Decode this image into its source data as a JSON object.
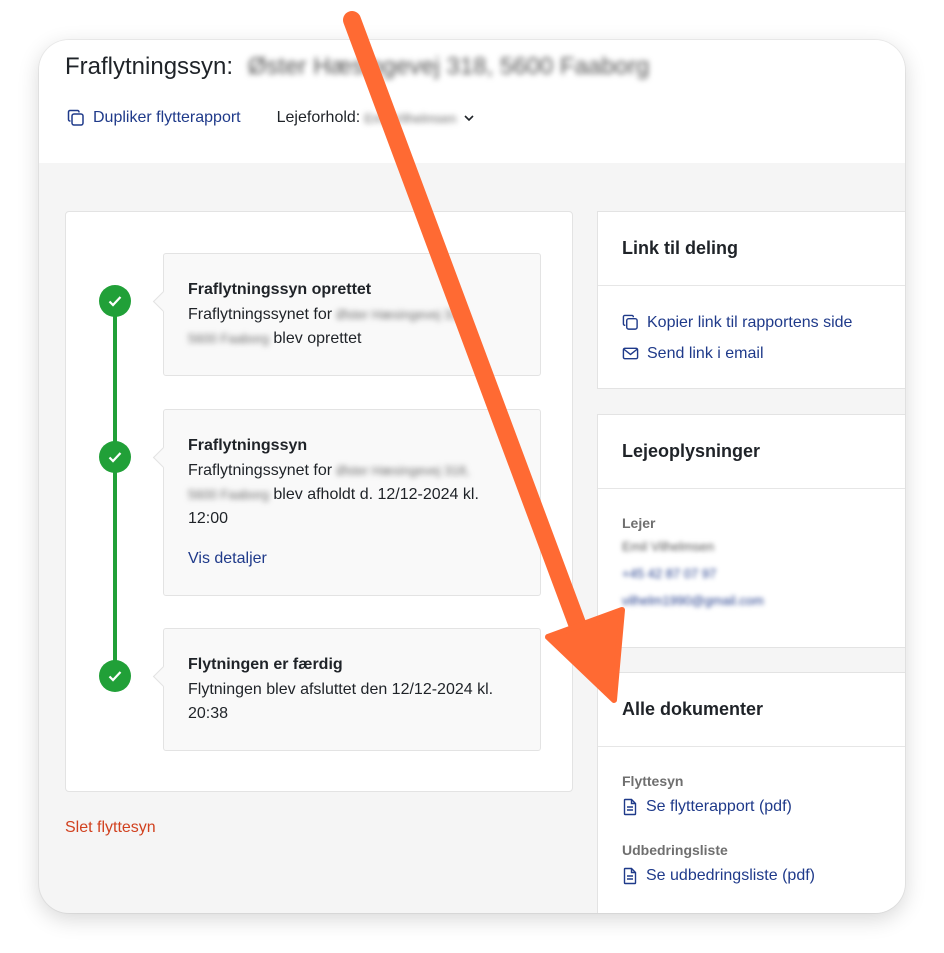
{
  "header": {
    "title_prefix": "Fraflytningssyn:",
    "address": "Øster Hæsingevej 318, 5600 Faaborg",
    "duplicate_label": "Dupliker flytterapport",
    "tenancy_label": "Lejeforhold:",
    "tenancy_value": "Emil Vilhelmsen"
  },
  "timeline": {
    "events": [
      {
        "title": "Fraflytningssyn oprettet",
        "text_before": "Fraflytningssynet for",
        "address_line1": "Øster Hæsingevej 318,",
        "address_line2": "5600 Faaborg",
        "text_after": "blev oprettet"
      },
      {
        "title": "Fraflytningssyn",
        "text_before": "Fraflytningssynet for",
        "address_line1": "Øster Hæsingevej 318,",
        "address_line2": "5600 Faaborg",
        "text_after": "blev afholdt d. 12/12-2024 kl.",
        "text_after_2": "12:00",
        "details_link": "Vis detaljer"
      },
      {
        "title": "Flytningen er færdig",
        "line1": "Flytningen blev afsluttet den 12/12-2024 kl.",
        "line2": "20:38"
      }
    ],
    "delete_label": "Slet flyttesyn"
  },
  "share": {
    "title": "Link til deling",
    "copy_label": "Kopier link til rapportens side",
    "email_label": "Send link i email"
  },
  "tenant": {
    "title": "Lejeoplysninger",
    "label": "Lejer",
    "name": "Emil Vilhelmsen",
    "phone": "+45 42 87 07 97",
    "email": "vilhelm1990@gmail.com"
  },
  "documents": {
    "title": "Alle dokumenter",
    "groups": [
      {
        "label": "Flyttesyn",
        "link": "Se flytterapport (pdf)"
      },
      {
        "label": "Udbedringsliste",
        "link": "Se udbedringsliste (pdf)"
      }
    ]
  },
  "colors": {
    "link": "#1f3a8a",
    "success": "#21a038",
    "danger": "#d1411f",
    "annotation_arrow": "#ff6a33"
  }
}
